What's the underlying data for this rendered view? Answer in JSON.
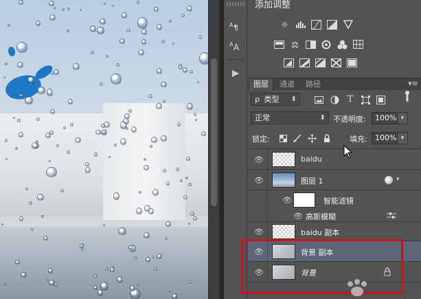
{
  "adjustments": {
    "title": "添加调整",
    "icons_row1": [
      "brightness-icon",
      "levels-icon",
      "curves-icon",
      "exposure-icon",
      "vibrance-icon"
    ],
    "icons_row2": [
      "hue-saturation-icon",
      "color-balance-icon",
      "black-white-icon",
      "photo-filter-icon",
      "channel-mixer-icon",
      "color-lookup-icon"
    ],
    "icons_row3": [
      "invert-icon",
      "posterize-icon",
      "threshold-icon",
      "selective-color-icon",
      "gradient-map-icon"
    ]
  },
  "tabs": [
    {
      "label": "图层",
      "active": true
    },
    {
      "label": "通道",
      "active": false
    },
    {
      "label": "路径",
      "active": false
    }
  ],
  "filter": {
    "kind": "类型"
  },
  "blend": {
    "mode": "正常",
    "opacity_label": "不透明度:",
    "opacity_value": "100%"
  },
  "lock": {
    "label": "锁定:",
    "fill_label": "填充:",
    "fill_value": "100%"
  },
  "layers": [
    {
      "name": "baidu",
      "visible": true,
      "thumb": "checker"
    },
    {
      "name": "图层 1",
      "visible": true,
      "thumb": "photo",
      "smart": true
    },
    {
      "name": "智能滤镜",
      "visible": true,
      "thumb": "white",
      "sub": true
    },
    {
      "name": "高斯模糊",
      "visible": true,
      "sub": true
    },
    {
      "name": "baidu 副本",
      "visible": true,
      "thumb": "checker"
    },
    {
      "name": "背景 副本",
      "visible": true,
      "thumb": "gray",
      "selected": true
    },
    {
      "name": "背景",
      "visible": true,
      "thumb": "gray",
      "italic": true,
      "locked": true
    }
  ],
  "colors": {
    "selection": "#5c6678",
    "highlight_box": "#d0101a",
    "panel": "#535353"
  }
}
